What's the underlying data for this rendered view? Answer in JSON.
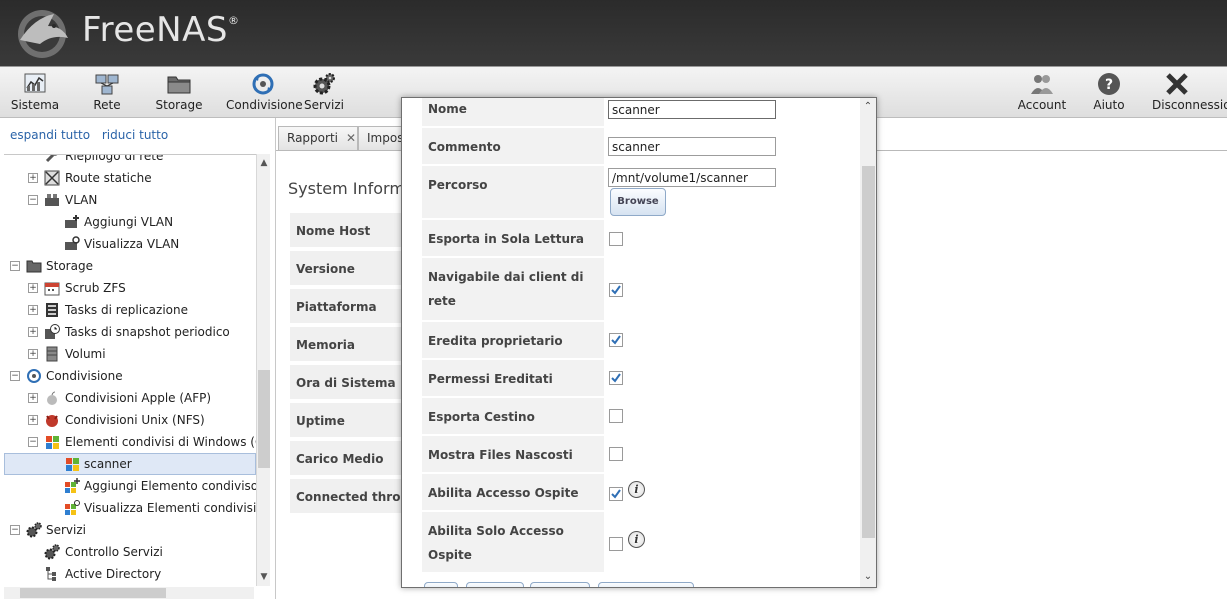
{
  "app": {
    "name": "FreeNAS",
    "reg": "®"
  },
  "toolbar": {
    "items": [
      {
        "label": "Sistema",
        "icon": "system-monitor-icon"
      },
      {
        "label": "Rete",
        "icon": "network-icon"
      },
      {
        "label": "Storage",
        "icon": "storage-folder-icon"
      },
      {
        "label": "Condivisione",
        "icon": "sharing-icon"
      },
      {
        "label": "Servizi",
        "icon": "services-gear-icon"
      },
      {
        "label": "Account",
        "icon": "users-icon"
      },
      {
        "label": "Aiuto",
        "icon": "help-icon"
      },
      {
        "label": "Disconnessio",
        "icon": "disconnect-x-icon"
      }
    ]
  },
  "sidebar": {
    "expand_all": "espandi tutto",
    "collapse_all": "riduci tutto",
    "tree": [
      {
        "label": "Riepilogo di rete",
        "toggle": ""
      },
      {
        "label": "Route statiche",
        "toggle": "+"
      },
      {
        "label": "VLAN",
        "toggle": "−"
      },
      {
        "label": "Aggiungi VLAN",
        "toggle": ""
      },
      {
        "label": "Visualizza VLAN",
        "toggle": ""
      },
      {
        "label": "Storage",
        "toggle": "−"
      },
      {
        "label": "Scrub ZFS",
        "toggle": "+"
      },
      {
        "label": "Tasks di replicazione",
        "toggle": "+"
      },
      {
        "label": "Tasks di snapshot periodico",
        "toggle": "+"
      },
      {
        "label": "Volumi",
        "toggle": "+"
      },
      {
        "label": "Condivisione",
        "toggle": "−"
      },
      {
        "label": "Condivisioni Apple (AFP)",
        "toggle": "+"
      },
      {
        "label": "Condivisioni Unix (NFS)",
        "toggle": "+"
      },
      {
        "label": "Elementi condivisi di Windows (C",
        "toggle": "−"
      },
      {
        "label": "scanner",
        "toggle": ""
      },
      {
        "label": "Aggiungi Elemento condiviso d",
        "toggle": ""
      },
      {
        "label": "Visualizza Elementi condivisi d",
        "toggle": ""
      },
      {
        "label": "Servizi",
        "toggle": "−"
      },
      {
        "label": "Controllo Servizi",
        "toggle": ""
      },
      {
        "label": "Active Directory",
        "toggle": ""
      }
    ]
  },
  "tabs": [
    {
      "label": "Rapporti",
      "close": "✕"
    },
    {
      "label": "Impos",
      "close": ""
    }
  ],
  "system_info": {
    "title": "System Informa",
    "rows": [
      "Nome Host",
      "Versione",
      "Piattaforma",
      "Memoria",
      "Ora di Sistema",
      "Uptime",
      "Carico Medio",
      "Connected throu"
    ]
  },
  "modal": {
    "fields": {
      "nome": {
        "label": "Nome",
        "value": "scanner"
      },
      "commento": {
        "label": "Commento",
        "value": "scanner"
      },
      "percorso": {
        "label": "Percorso",
        "value": "/mnt/volume1/scanner",
        "browse": "Browse"
      },
      "sola_lettura": {
        "label": "Esporta in Sola Lettura",
        "checked": false
      },
      "navigabile": {
        "label": "Navigabile dai client di rete",
        "checked": true
      },
      "eredita_prop": {
        "label": "Eredita proprietario",
        "checked": true
      },
      "permessi_ered": {
        "label": "Permessi Ereditati",
        "checked": true
      },
      "cestino": {
        "label": "Esporta Cestino",
        "checked": false
      },
      "nascosti": {
        "label": "Mostra Files Nascosti",
        "checked": false
      },
      "ospite": {
        "label": "Abilita Accesso Ospite",
        "checked": true,
        "info": "i"
      },
      "solo_ospite": {
        "label": "Abilita Solo Accesso Ospite",
        "checked": false,
        "info": "i"
      }
    }
  }
}
